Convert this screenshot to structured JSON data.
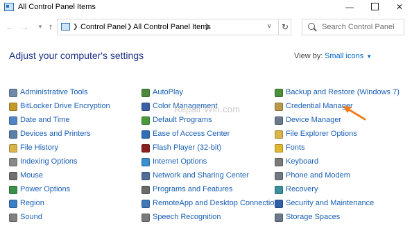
{
  "window": {
    "title": "All Control Panel Items"
  },
  "address": {
    "crumbs": [
      "Control Panel",
      "All Control Panel Items"
    ]
  },
  "search": {
    "placeholder": "Search Control Panel"
  },
  "heading": "Adjust your computer's settings",
  "view_by": {
    "label": "View by:",
    "value": "Small icons"
  },
  "watermark": "Repair Win.com",
  "colors": {
    "link": "#1a5fb4",
    "heading": "#1e3287",
    "accent_arrow": "#f07c1d"
  },
  "items": {
    "col1": [
      {
        "label": "Administrative Tools",
        "icon": "administrative-tools-icon",
        "color": "#6e8aa8"
      },
      {
        "label": "BitLocker Drive Encryption",
        "icon": "bitlocker-icon",
        "color": "#c49a2b"
      },
      {
        "label": "Date and Time",
        "icon": "date-time-icon",
        "color": "#4f86c6"
      },
      {
        "label": "Devices and Printers",
        "icon": "devices-printers-icon",
        "color": "#5a7fa8"
      },
      {
        "label": "File History",
        "icon": "file-history-icon",
        "color": "#d9b44a"
      },
      {
        "label": "Indexing Options",
        "icon": "indexing-options-icon",
        "color": "#8a8a8a"
      },
      {
        "label": "Mouse",
        "icon": "mouse-icon",
        "color": "#707070"
      },
      {
        "label": "Power Options",
        "icon": "power-options-icon",
        "color": "#3a8f4a"
      },
      {
        "label": "Region",
        "icon": "region-icon",
        "color": "#3b7fc4"
      },
      {
        "label": "Sound",
        "icon": "sound-icon",
        "color": "#808080"
      }
    ],
    "col2": [
      {
        "label": "AutoPlay",
        "icon": "autoplay-icon",
        "color": "#4a8a3a"
      },
      {
        "label": "Color Management",
        "icon": "color-management-icon",
        "color": "#3a5fa8"
      },
      {
        "label": "Default Programs",
        "icon": "default-programs-icon",
        "color": "#4a9a3a"
      },
      {
        "label": "Ease of Access Center",
        "icon": "ease-of-access-icon",
        "color": "#2f6fb8"
      },
      {
        "label": "Flash Player (32-bit)",
        "icon": "flash-player-icon",
        "color": "#8a1f1f"
      },
      {
        "label": "Internet Options",
        "icon": "internet-options-icon",
        "color": "#3a8fd0"
      },
      {
        "label": "Network and Sharing Center",
        "icon": "network-sharing-icon",
        "color": "#4f6f9a"
      },
      {
        "label": "Programs and Features",
        "icon": "programs-features-icon",
        "color": "#6a6a6a"
      },
      {
        "label": "RemoteApp and Desktop Connections",
        "icon": "remoteapp-icon",
        "color": "#3f78b8"
      },
      {
        "label": "Speech Recognition",
        "icon": "speech-recognition-icon",
        "color": "#7a7a7a"
      }
    ],
    "col3": [
      {
        "label": "Backup and Restore (Windows 7)",
        "icon": "backup-restore-icon",
        "color": "#4a8f3a"
      },
      {
        "label": "Credential Manager",
        "icon": "credential-manager-icon",
        "color": "#b89a4a"
      },
      {
        "label": "Device Manager",
        "icon": "device-manager-icon",
        "color": "#6a7a8a"
      },
      {
        "label": "File Explorer Options",
        "icon": "file-explorer-options-icon",
        "color": "#d9b44a"
      },
      {
        "label": "Fonts",
        "icon": "fonts-icon",
        "color": "#e0b830"
      },
      {
        "label": "Keyboard",
        "icon": "keyboard-icon",
        "color": "#7a7a7a"
      },
      {
        "label": "Phone and Modem",
        "icon": "phone-modem-icon",
        "color": "#707a84"
      },
      {
        "label": "Recovery",
        "icon": "recovery-icon",
        "color": "#3a8fa0"
      },
      {
        "label": "Security and Maintenance",
        "icon": "security-maintenance-icon",
        "color": "#2f5fa8"
      },
      {
        "label": "Storage Spaces",
        "icon": "storage-spaces-icon",
        "color": "#6a7a8a"
      }
    ]
  }
}
